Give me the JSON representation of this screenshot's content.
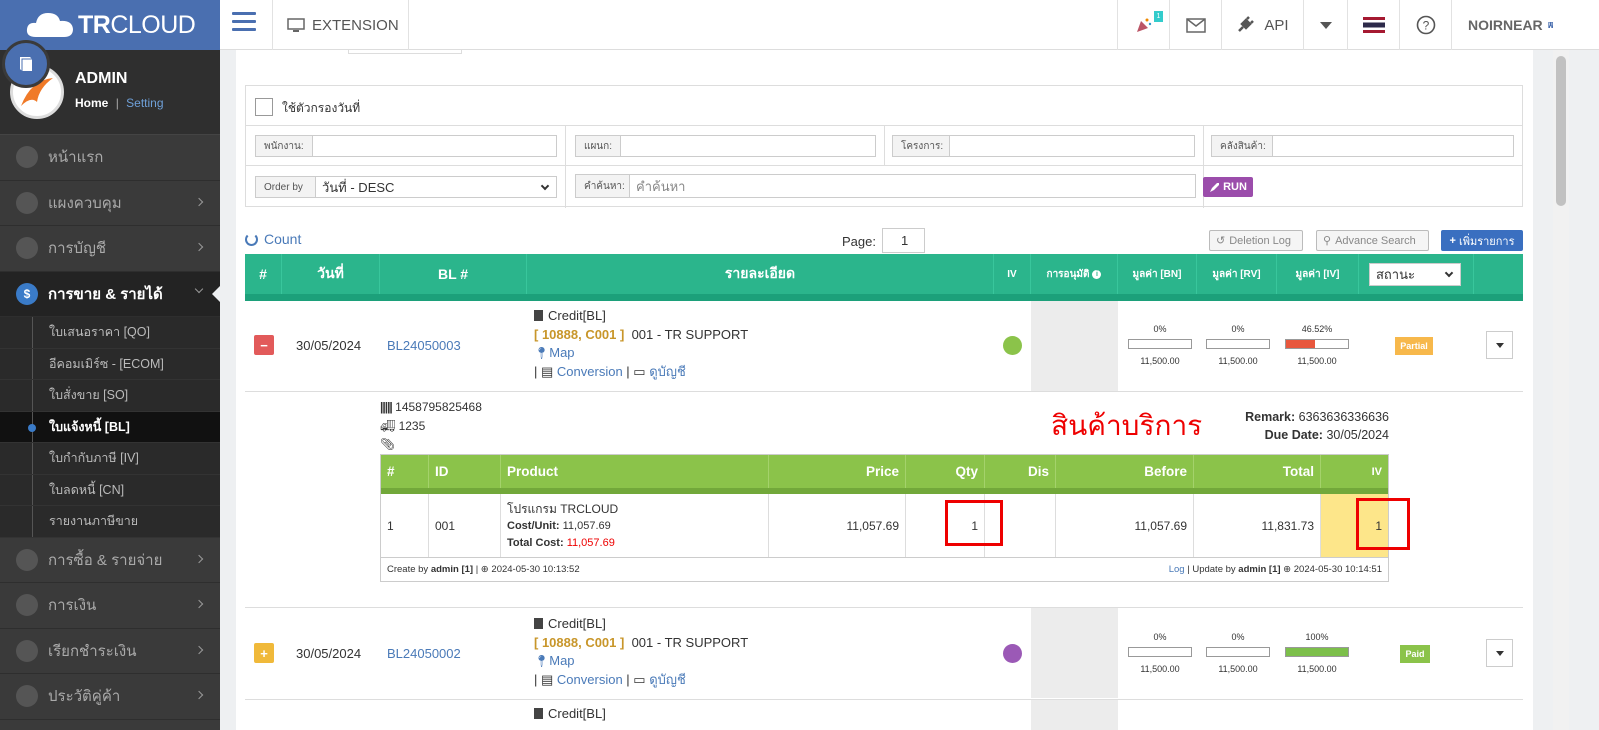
{
  "app": {
    "brand_bold": "TR",
    "brand_rest": "CLOUD"
  },
  "topbar": {
    "extension_label": "EXTENSION",
    "notification_count": "1",
    "api_label": "API",
    "user_label": "NOIRNEAR"
  },
  "profile": {
    "name": "ADMIN",
    "home": "Home",
    "separator": "|",
    "setting": "Setting"
  },
  "sidebar": {
    "items": [
      {
        "label": "หน้าแรก"
      },
      {
        "label": "แผงควบคุม"
      },
      {
        "label": "การบัญชี"
      },
      {
        "label": "การขาย & รายได้"
      },
      {
        "label": "การซื้อ & รายจ่าย"
      },
      {
        "label": "การเงิน"
      },
      {
        "label": "เรียกชำระเงิน"
      },
      {
        "label": "ประวัติคู่ค้า"
      }
    ],
    "sub_items": [
      {
        "label": "ใบเสนอราคา [QO]"
      },
      {
        "label": "อีคอมเมิร์ซ - [ECOM]"
      },
      {
        "label": "ใบสั่งขาย [SO]"
      },
      {
        "label": "ใบแจ้งหนี้ [BL]"
      },
      {
        "label": "ใบกำกับภาษี [IV]"
      },
      {
        "label": "ใบลดหนี้ [CN]"
      },
      {
        "label": "รายงานภาษีขาย"
      }
    ]
  },
  "filters": {
    "date_filter_label": "ใช้ตัวกรองวันที่",
    "employee_label": "พนักงาน:",
    "department_label": "แผนก:",
    "project_label": "โครงการ:",
    "warehouse_label": "คลังสินค้า:",
    "order_by_label": "Order by",
    "order_by_value": "วันที่ - DESC",
    "search_label": "คำค้นหา:",
    "search_placeholder": "คำค้นหา",
    "run_label": "RUN"
  },
  "toolbar": {
    "count_label": "Count",
    "page_label": "Page:",
    "page_value": "1",
    "deletion_log": "Deletion Log",
    "advance_search": "Advance Search",
    "add_item": "เพิ่มรายการ"
  },
  "table": {
    "headers": {
      "num": "#",
      "date": "วันที่",
      "bl": "BL #",
      "detail": "รายละเอียด",
      "iv": "IV",
      "approval": "การอนุมัติ",
      "value_bn": "มูลค่า [BN]",
      "value_rv": "มูลค่า [RV]",
      "value_iv": "มูลค่า [IV]",
      "status_select": "สถานะ"
    },
    "rows": [
      {
        "date": "30/05/2024",
        "bl": "BL24050003",
        "type": "Credit[BL]",
        "code": "[ 10888, C001 ]",
        "customer": "001 - TR SUPPORT",
        "map": "Map",
        "conversion": "Conversion",
        "view_account": "ดูบัญชี",
        "dot_color": "#8bc34a",
        "bn_pct": "0%",
        "bn_amt": "11,500.00",
        "bn_fill": 0,
        "rv_pct": "0%",
        "rv_amt": "11,500.00",
        "rv_fill": 0,
        "iv_pct": "46.52%",
        "iv_amt": "11,500.00",
        "iv_fill": 0.4652,
        "status": "Partial",
        "status_color": "#f7b84b",
        "iv_fill_color": "#e8573d"
      },
      {
        "date": "30/05/2024",
        "bl": "BL24050002",
        "type": "Credit[BL]",
        "code": "[ 10888, C001 ]",
        "customer": "001 - TR SUPPORT",
        "map": "Map",
        "conversion": "Conversion",
        "view_account": "ดูบัญชี",
        "dot_color": "#9b59b6",
        "bn_pct": "0%",
        "bn_amt": "11,500.00",
        "bn_fill": 0,
        "rv_pct": "0%",
        "rv_amt": "11,500.00",
        "rv_fill": 0,
        "iv_pct": "100%",
        "iv_amt": "11,500.00",
        "iv_fill": 1,
        "status": "Paid",
        "status_color": "#8bc34a",
        "iv_fill_color": "#7cbf4a"
      }
    ],
    "next_row_type": "Credit[BL]"
  },
  "expanded": {
    "barcode": "1458795825468",
    "shipping": "1235",
    "service_title": "สินค้าบริการ",
    "remark_label": "Remark:",
    "remark_value": "6363636336636",
    "due_label": "Due Date:",
    "due_value": "30/05/2024",
    "items_headers": {
      "num": "#",
      "id": "ID",
      "product": "Product",
      "price": "Price",
      "qty": "Qty",
      "dis": "Dis",
      "before": "Before",
      "total": "Total",
      "iv": "IV"
    },
    "item": {
      "num": "1",
      "id": "001",
      "product": "โปรแกรม TRCLOUD",
      "cost_unit_label": "Cost/Unit:",
      "cost_unit": "11,057.69",
      "total_cost_label": "Total Cost:",
      "total_cost": "11,057.69",
      "price": "11,057.69",
      "qty": "1",
      "dis": "",
      "before": "11,057.69",
      "total": "11,831.73",
      "iv": "1"
    },
    "footer_left_pre": "Create by",
    "footer_left_user": "admin [1]",
    "footer_left_time": "| ⊕ 2024-05-30 10:13:52",
    "footer_log": "Log",
    "footer_right_pre": "| Update by",
    "footer_right_user": "admin [1]",
    "footer_right_time": "⊕ 2024-05-30 10:14:51"
  },
  "colors": {
    "accent": "#4a6fb0",
    "table_header": "#2bb58c",
    "items_header": "#8bc34a",
    "highlight": "#e00000"
  }
}
